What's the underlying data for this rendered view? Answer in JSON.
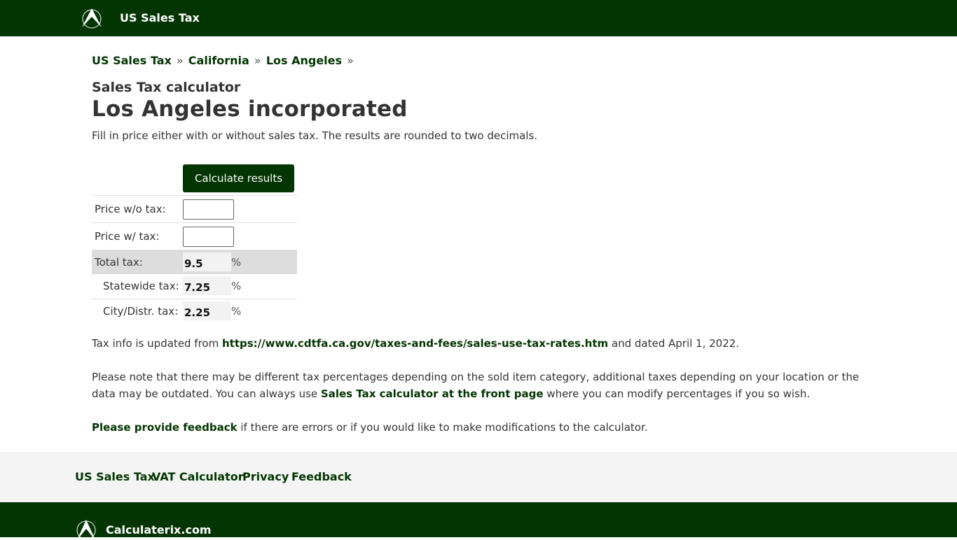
{
  "header": {
    "logo_icon": "calculaterix-logo-icon",
    "site_title": "US Sales Tax"
  },
  "breadcrumb": {
    "items": [
      "US Sales Tax",
      "California",
      "Los Angeles"
    ],
    "separator": "»"
  },
  "page": {
    "subtitle": "Sales Tax calculator",
    "title": "Los Angeles incorporated",
    "intro": "Fill in price either with or without sales tax. The results are rounded to two decimals."
  },
  "calculator": {
    "button_label": "Calculate results",
    "price_without_tax_label": "Price w/o tax:",
    "price_without_tax_value": "",
    "price_with_tax_label": "Price w/ tax:",
    "price_with_tax_value": "",
    "total_tax_label": "Total tax:",
    "total_tax_value": "9.5",
    "statewide_tax_label": "Statewide tax:",
    "statewide_tax_value": "7.25",
    "city_tax_label": "City/Distr. tax:",
    "city_tax_value": "2.25",
    "percent_sign": "%"
  },
  "info": {
    "p1_prefix": "Tax info is updated from ",
    "p1_link": "https://www.cdtfa.ca.gov/taxes-and-fees/sales-use-tax-rates.htm",
    "p1_suffix": " and dated April 1, 2022.",
    "p2_prefix": "Please note that there may be different tax percentages depending on the sold item category, additional taxes depending on your location or the data may be outdated. You can always use ",
    "p2_link": "Sales Tax calculator at the front page",
    "p2_suffix": " where you can modify percentages if you so wish.",
    "p3_link": "Please provide feedback",
    "p3_suffix": " if there are errors or if you would like to make modifications to the calculator."
  },
  "footer": {
    "links": [
      "US Sales Tax",
      "VAT Calculator",
      "Privacy",
      "Feedback"
    ],
    "brand": "Calculaterix.com"
  },
  "colors": {
    "brand_green": "#023502",
    "footer_gray": "#f4f4f4",
    "total_row_gray": "#dddddd"
  }
}
